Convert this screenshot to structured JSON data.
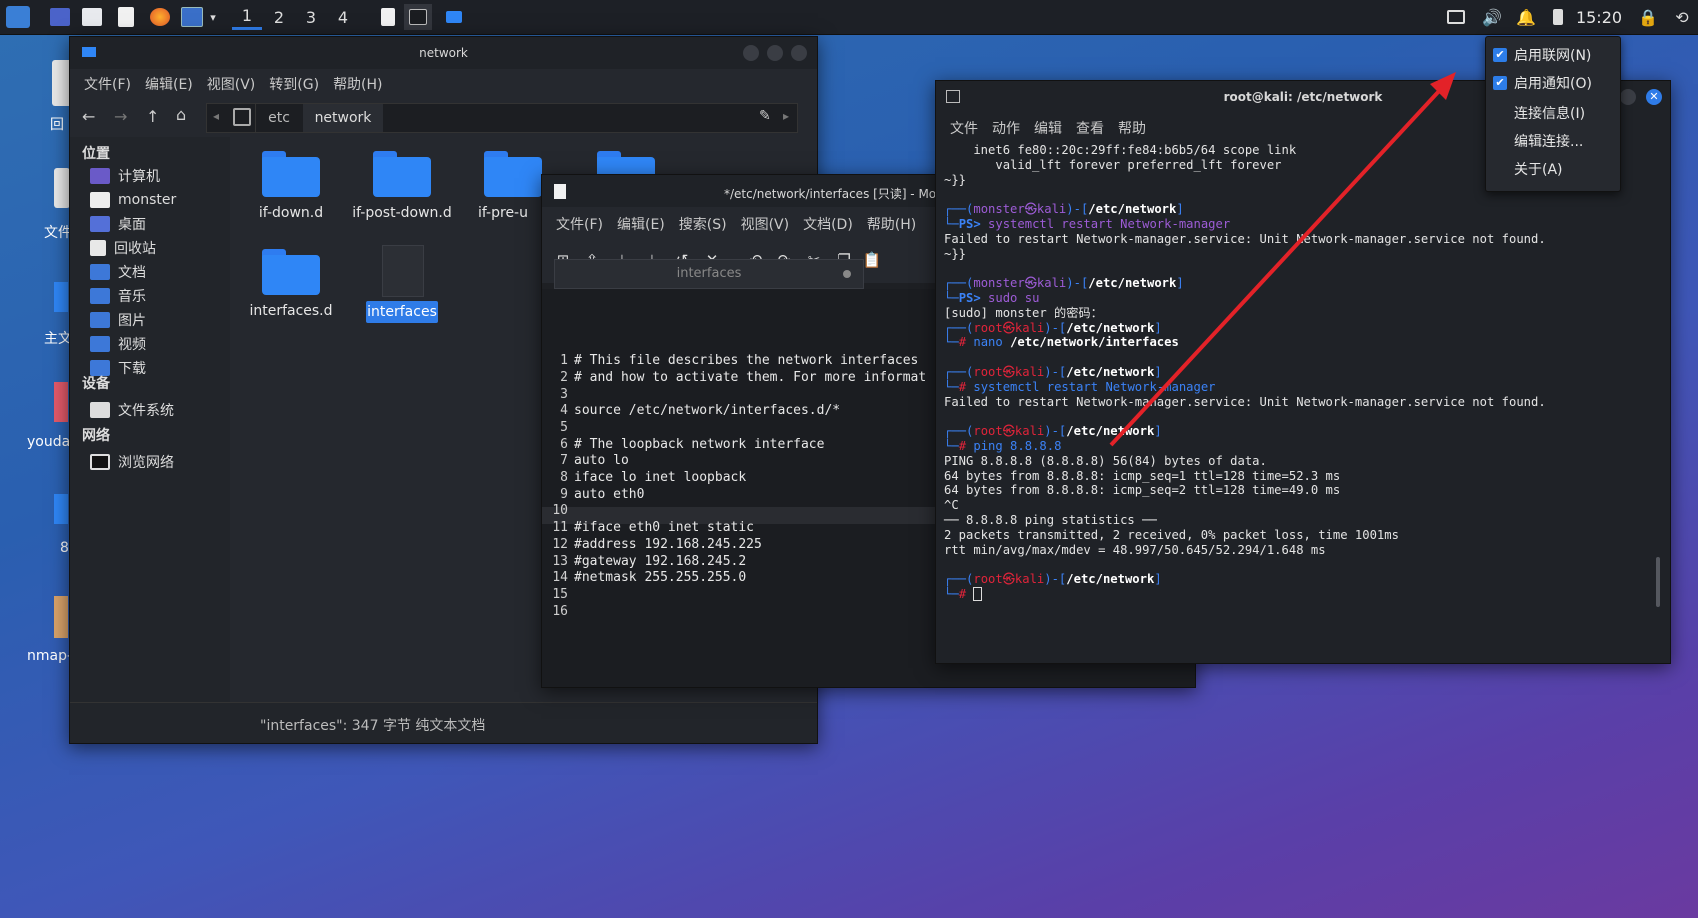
{
  "panel": {
    "workspaces": [
      "1",
      "2",
      "3",
      "4"
    ],
    "clock": "15:20"
  },
  "desktop": {
    "icons": [
      "回",
      "文件",
      "主文",
      "youda",
      "8",
      "nmap-"
    ]
  },
  "file_manager": {
    "title": "network",
    "menu": [
      "文件(F)",
      "编辑(E)",
      "视图(V)",
      "转到(G)",
      "帮助(H)"
    ],
    "path": [
      "etc",
      "network"
    ],
    "sidebar": {
      "places_header": "位置",
      "places": [
        "计算机",
        "monster",
        "桌面",
        "回收站",
        "文档",
        "音乐",
        "图片",
        "视频",
        "下载"
      ],
      "devices_header": "设备",
      "devices": [
        "文件系统"
      ],
      "network_header": "网络",
      "network": [
        "浏览网络"
      ]
    },
    "items": [
      "if-down.d",
      "if-post-down.d",
      "if-pre-u",
      "interfaces.d",
      "interfaces"
    ],
    "status": "\"interfaces\": 347 字节 纯文本文档"
  },
  "editor": {
    "title": "*/etc/network/interfaces [只读] - Mou",
    "menu": [
      "文件(F)",
      "编辑(E)",
      "搜索(S)",
      "视图(V)",
      "文档(D)",
      "帮助(H)"
    ],
    "tab": "interfaces",
    "lines": [
      "# This file describes the network interfaces",
      "# and how to activate them. For more informat",
      "",
      "source /etc/network/interfaces.d/*",
      "",
      "# The loopback network interface",
      "auto lo",
      "iface lo inet loopback",
      "auto eth0",
      "",
      "#iface eth0 inet static",
      "#address 192.168.245.225",
      "#gateway 192.168.245.2",
      "#netmask 255.255.255.0",
      "",
      ""
    ],
    "line_numbers": [
      "1",
      "2",
      "3",
      "4",
      "5",
      "6",
      "7",
      "8",
      "9",
      "10",
      "11",
      "12",
      "13",
      "14",
      "15",
      "16"
    ]
  },
  "terminal": {
    "title": "root@kali: /etc/network",
    "menu": [
      "文件",
      "动作",
      "编辑",
      "查看",
      "帮助"
    ],
    "l1": "    inet6 fe80::20c:29ff:fe84:b6b5/64 scope link",
    "l2": "       valid_lft forever preferred_lft forever",
    "l3": "~}}",
    "user1": "monster㉿kali",
    "dir": "/etc/network",
    "ps": "PS> ",
    "cmd1": "systemctl restart Network-manager",
    "err1": "Failed to restart Network-manager.service: Unit Network-manager.service not found.",
    "l4": "~}}",
    "cmd2": "sudo su",
    "sudo_prompt": "[sudo] monster 的密码：",
    "user2": "root㉿kali",
    "cmd3a": "nano ",
    "cmd3b": "/etc/network/interfaces",
    "cmd4": "systemctl restart Network-manager",
    "err2": "Failed to restart Network-manager.service: Unit Network-manager.service not found.",
    "cmd5": "ping 8.8.8.8",
    "p1": "PING 8.8.8.8 (8.8.8.8) 56(84) bytes of data.",
    "p2": "64 bytes from 8.8.8.8: icmp_seq=1 ttl=128 time=52.3 ms",
    "p3": "64 bytes from 8.8.8.8: icmp_seq=2 ttl=128 time=49.0 ms",
    "p4": "^C",
    "p5": "── 8.8.8.8 ping statistics ──",
    "p6": "2 packets transmitted, 2 received, 0% packet loss, time 1001ms",
    "p7": "rtt min/avg/max/mdev = 48.997/50.645/52.294/1.648 ms"
  },
  "network_menu": {
    "items": [
      "启用联网(N)",
      "启用通知(O)",
      "连接信息(I)",
      "编辑连接...",
      "关于(A)"
    ],
    "checked": [
      true,
      true,
      false,
      false,
      false
    ]
  },
  "colors": {
    "accent": "#2f7ce8",
    "arrow": "#e32228"
  }
}
